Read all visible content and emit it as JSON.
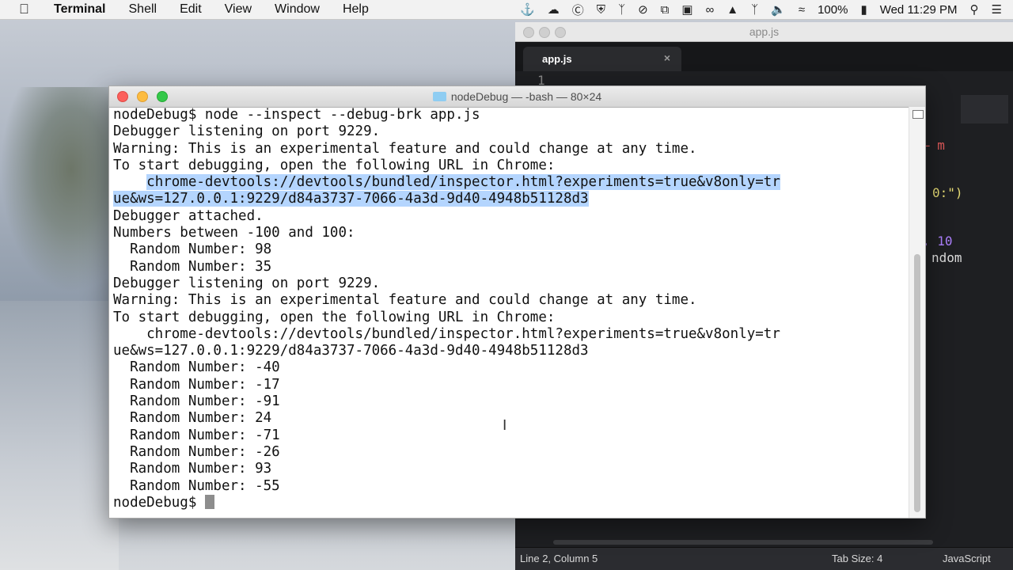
{
  "menubar": {
    "apple_icon": "apple-logo-icon",
    "app_name": "Terminal",
    "items": [
      "Shell",
      "Edit",
      "View",
      "Window",
      "Help"
    ],
    "battery": "100%",
    "clock": "Wed 11:29 PM"
  },
  "editor": {
    "window_title": "app.js",
    "tab_label": "app.js",
    "tab_close": "×",
    "gutter_line": "1",
    "code_fragments": {
      "a": "– m",
      "b": "0:\")",
      "c": ", 10",
      "d": "ndom"
    },
    "status": {
      "position": "Line 2, Column 5",
      "tab_size": "Tab Size: 4",
      "language": "JavaScript"
    }
  },
  "terminal": {
    "window_title": "nodeDebug — -bash — 80×24",
    "lines": [
      "nodeDebug$ node --inspect --debug-brk app.js",
      "Debugger listening on port 9229.",
      "Warning: This is an experimental feature and could change at any time.",
      "To start debugging, open the following URL in Chrome:",
      "    chrome-devtools://devtools/bundled/inspector.html?experiments=true&v8only=tr",
      "ue&ws=127.0.0.1:9229/d84a3737-7066-4a3d-9d40-4948b51128d3",
      "Debugger attached.",
      "Numbers between -100 and 100:",
      "  Random Number: 98",
      "  Random Number: 35",
      "Debugger listening on port 9229.",
      "Warning: This is an experimental feature and could change at any time.",
      "To start debugging, open the following URL in Chrome:",
      "    chrome-devtools://devtools/bundled/inspector.html?experiments=true&v8only=tr",
      "ue&ws=127.0.0.1:9229/d84a3737-7066-4a3d-9d40-4948b51128d3",
      "  Random Number: -40",
      "  Random Number: -17",
      "  Random Number: -91",
      "  Random Number: 24",
      "  Random Number: -71",
      "  Random Number: -26",
      "  Random Number: 93",
      "  Random Number: -55"
    ],
    "prompt": "nodeDebug$ ",
    "selected_line_indices": [
      4,
      5
    ],
    "selection_color": "#b4d5fe"
  }
}
